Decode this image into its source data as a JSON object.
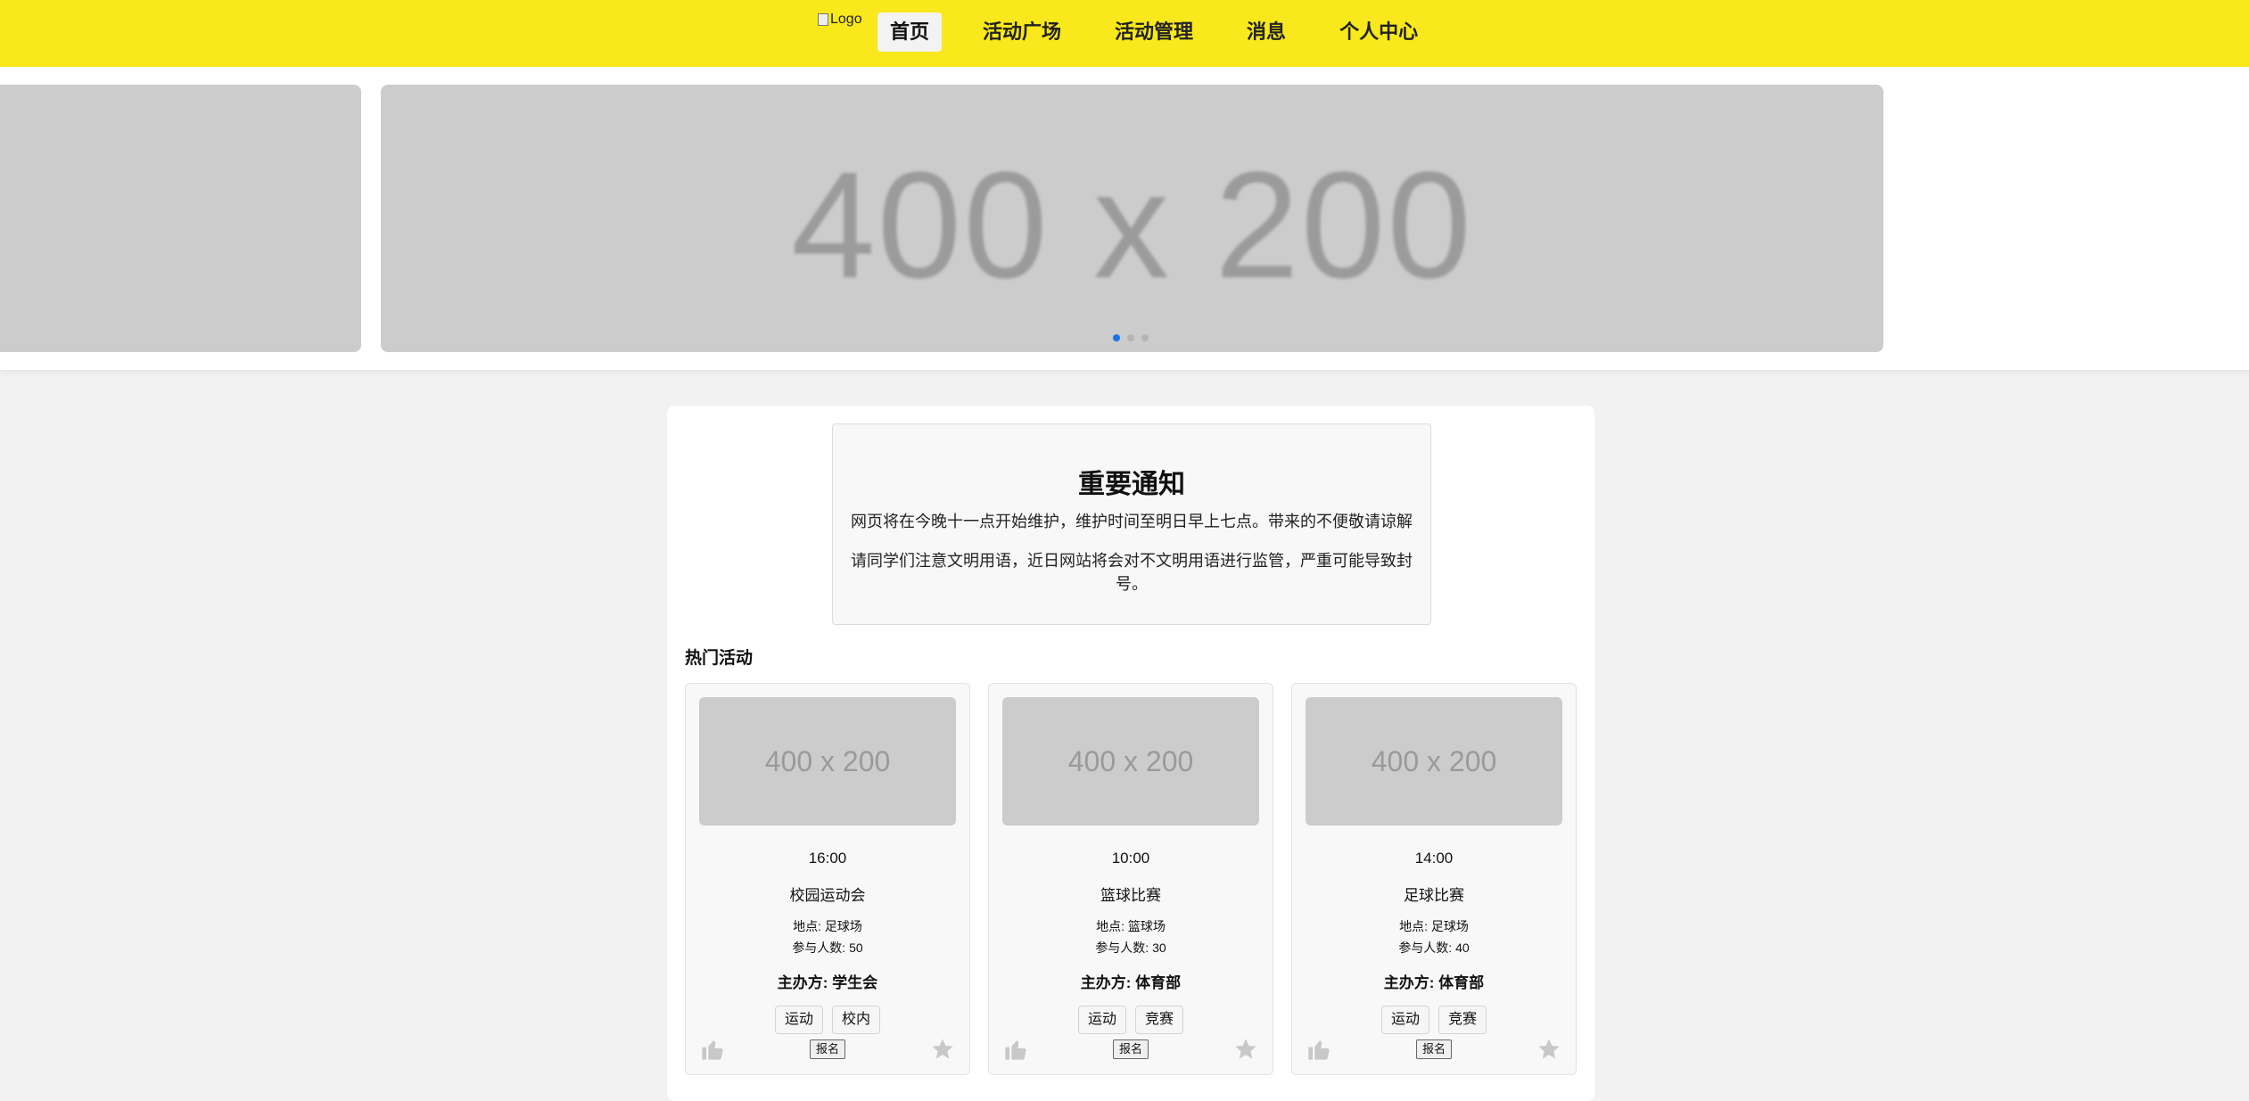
{
  "header": {
    "logo_alt": "Logo",
    "nav": [
      {
        "label": "首页",
        "active": true
      },
      {
        "label": "活动广场",
        "active": false
      },
      {
        "label": "活动管理",
        "active": false
      },
      {
        "label": "消息",
        "active": false
      },
      {
        "label": "个人中心",
        "active": false
      }
    ],
    "bg_color": "#f8e81c"
  },
  "carousel": {
    "slide_text": "400 x 200",
    "dots": 3,
    "active_dot": 0,
    "dot_active_color": "#1a73e8"
  },
  "notice": {
    "title": "重要通知",
    "line1": "网页将在今晚十一点开始维护，维护时间至明日早上七点。带来的不便敬请谅解",
    "line2": "请同学们注意文明用语，近日网站将会对不文明用语进行监管，严重可能导致封号。"
  },
  "hot": {
    "title": "热门活动",
    "cards": [
      {
        "image_text": "400 x 200",
        "time": "16:00",
        "name": "校园运动会",
        "location": "地点: 足球场",
        "count": "参与人数: 50",
        "organizer": "主办方: 学生会",
        "tags": [
          "运动",
          "校内"
        ],
        "signup": "报名",
        "like_icon": "thumbs-up-icon",
        "star_icon": "star-icon"
      },
      {
        "image_text": "400 x 200",
        "time": "10:00",
        "name": "篮球比赛",
        "location": "地点: 篮球场",
        "count": "参与人数: 30",
        "organizer": "主办方: 体育部",
        "tags": [
          "运动",
          "竞赛"
        ],
        "signup": "报名",
        "like_icon": "thumbs-up-icon",
        "star_icon": "star-icon"
      },
      {
        "image_text": "400 x 200",
        "time": "14:00",
        "name": "足球比赛",
        "location": "地点: 足球场",
        "count": "参与人数: 40",
        "organizer": "主办方: 体育部",
        "tags": [
          "运动",
          "竞赛"
        ],
        "signup": "报名",
        "like_icon": "thumbs-up-icon",
        "star_icon": "star-icon"
      }
    ]
  }
}
